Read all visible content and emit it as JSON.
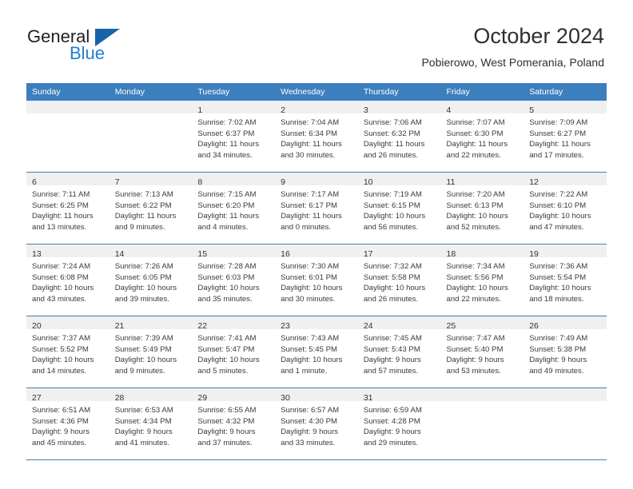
{
  "brand": {
    "name_top": "General",
    "name_bottom": "Blue",
    "color_dark": "#231f20",
    "color_blue": "#1b7fd4",
    "triangle_color": "#1763a8"
  },
  "header": {
    "title": "October 2024",
    "subtitle": "Pobierowo, West Pomerania, Poland"
  },
  "theme": {
    "header_blue": "#3c7fbe",
    "daynum_bg": "#f0f0f0",
    "text": "#3a3a3a"
  },
  "weekdays": [
    "Sunday",
    "Monday",
    "Tuesday",
    "Wednesday",
    "Thursday",
    "Friday",
    "Saturday"
  ],
  "weeks": [
    [
      {
        "day": "",
        "lines": []
      },
      {
        "day": "",
        "lines": []
      },
      {
        "day": "1",
        "lines": [
          "Sunrise: 7:02 AM",
          "Sunset: 6:37 PM",
          "Daylight: 11 hours",
          "and 34 minutes."
        ]
      },
      {
        "day": "2",
        "lines": [
          "Sunrise: 7:04 AM",
          "Sunset: 6:34 PM",
          "Daylight: 11 hours",
          "and 30 minutes."
        ]
      },
      {
        "day": "3",
        "lines": [
          "Sunrise: 7:06 AM",
          "Sunset: 6:32 PM",
          "Daylight: 11 hours",
          "and 26 minutes."
        ]
      },
      {
        "day": "4",
        "lines": [
          "Sunrise: 7:07 AM",
          "Sunset: 6:30 PM",
          "Daylight: 11 hours",
          "and 22 minutes."
        ]
      },
      {
        "day": "5",
        "lines": [
          "Sunrise: 7:09 AM",
          "Sunset: 6:27 PM",
          "Daylight: 11 hours",
          "and 17 minutes."
        ]
      }
    ],
    [
      {
        "day": "6",
        "lines": [
          "Sunrise: 7:11 AM",
          "Sunset: 6:25 PM",
          "Daylight: 11 hours",
          "and 13 minutes."
        ]
      },
      {
        "day": "7",
        "lines": [
          "Sunrise: 7:13 AM",
          "Sunset: 6:22 PM",
          "Daylight: 11 hours",
          "and 9 minutes."
        ]
      },
      {
        "day": "8",
        "lines": [
          "Sunrise: 7:15 AM",
          "Sunset: 6:20 PM",
          "Daylight: 11 hours",
          "and 4 minutes."
        ]
      },
      {
        "day": "9",
        "lines": [
          "Sunrise: 7:17 AM",
          "Sunset: 6:17 PM",
          "Daylight: 11 hours",
          "and 0 minutes."
        ]
      },
      {
        "day": "10",
        "lines": [
          "Sunrise: 7:19 AM",
          "Sunset: 6:15 PM",
          "Daylight: 10 hours",
          "and 56 minutes."
        ]
      },
      {
        "day": "11",
        "lines": [
          "Sunrise: 7:20 AM",
          "Sunset: 6:13 PM",
          "Daylight: 10 hours",
          "and 52 minutes."
        ]
      },
      {
        "day": "12",
        "lines": [
          "Sunrise: 7:22 AM",
          "Sunset: 6:10 PM",
          "Daylight: 10 hours",
          "and 47 minutes."
        ]
      }
    ],
    [
      {
        "day": "13",
        "lines": [
          "Sunrise: 7:24 AM",
          "Sunset: 6:08 PM",
          "Daylight: 10 hours",
          "and 43 minutes."
        ]
      },
      {
        "day": "14",
        "lines": [
          "Sunrise: 7:26 AM",
          "Sunset: 6:05 PM",
          "Daylight: 10 hours",
          "and 39 minutes."
        ]
      },
      {
        "day": "15",
        "lines": [
          "Sunrise: 7:28 AM",
          "Sunset: 6:03 PM",
          "Daylight: 10 hours",
          "and 35 minutes."
        ]
      },
      {
        "day": "16",
        "lines": [
          "Sunrise: 7:30 AM",
          "Sunset: 6:01 PM",
          "Daylight: 10 hours",
          "and 30 minutes."
        ]
      },
      {
        "day": "17",
        "lines": [
          "Sunrise: 7:32 AM",
          "Sunset: 5:58 PM",
          "Daylight: 10 hours",
          "and 26 minutes."
        ]
      },
      {
        "day": "18",
        "lines": [
          "Sunrise: 7:34 AM",
          "Sunset: 5:56 PM",
          "Daylight: 10 hours",
          "and 22 minutes."
        ]
      },
      {
        "day": "19",
        "lines": [
          "Sunrise: 7:36 AM",
          "Sunset: 5:54 PM",
          "Daylight: 10 hours",
          "and 18 minutes."
        ]
      }
    ],
    [
      {
        "day": "20",
        "lines": [
          "Sunrise: 7:37 AM",
          "Sunset: 5:52 PM",
          "Daylight: 10 hours",
          "and 14 minutes."
        ]
      },
      {
        "day": "21",
        "lines": [
          "Sunrise: 7:39 AM",
          "Sunset: 5:49 PM",
          "Daylight: 10 hours",
          "and 9 minutes."
        ]
      },
      {
        "day": "22",
        "lines": [
          "Sunrise: 7:41 AM",
          "Sunset: 5:47 PM",
          "Daylight: 10 hours",
          "and 5 minutes."
        ]
      },
      {
        "day": "23",
        "lines": [
          "Sunrise: 7:43 AM",
          "Sunset: 5:45 PM",
          "Daylight: 10 hours",
          "and 1 minute."
        ]
      },
      {
        "day": "24",
        "lines": [
          "Sunrise: 7:45 AM",
          "Sunset: 5:43 PM",
          "Daylight: 9 hours",
          "and 57 minutes."
        ]
      },
      {
        "day": "25",
        "lines": [
          "Sunrise: 7:47 AM",
          "Sunset: 5:40 PM",
          "Daylight: 9 hours",
          "and 53 minutes."
        ]
      },
      {
        "day": "26",
        "lines": [
          "Sunrise: 7:49 AM",
          "Sunset: 5:38 PM",
          "Daylight: 9 hours",
          "and 49 minutes."
        ]
      }
    ],
    [
      {
        "day": "27",
        "lines": [
          "Sunrise: 6:51 AM",
          "Sunset: 4:36 PM",
          "Daylight: 9 hours",
          "and 45 minutes."
        ]
      },
      {
        "day": "28",
        "lines": [
          "Sunrise: 6:53 AM",
          "Sunset: 4:34 PM",
          "Daylight: 9 hours",
          "and 41 minutes."
        ]
      },
      {
        "day": "29",
        "lines": [
          "Sunrise: 6:55 AM",
          "Sunset: 4:32 PM",
          "Daylight: 9 hours",
          "and 37 minutes."
        ]
      },
      {
        "day": "30",
        "lines": [
          "Sunrise: 6:57 AM",
          "Sunset: 4:30 PM",
          "Daylight: 9 hours",
          "and 33 minutes."
        ]
      },
      {
        "day": "31",
        "lines": [
          "Sunrise: 6:59 AM",
          "Sunset: 4:28 PM",
          "Daylight: 9 hours",
          "and 29 minutes."
        ]
      },
      {
        "day": "",
        "lines": []
      },
      {
        "day": "",
        "lines": []
      }
    ]
  ]
}
